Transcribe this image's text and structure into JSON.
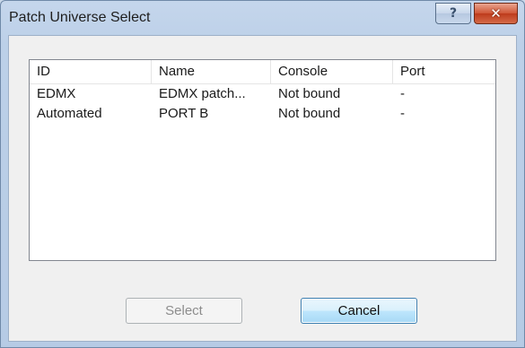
{
  "window": {
    "title": "Patch Universe Select",
    "help_glyph": "?",
    "close_glyph": "✕"
  },
  "list": {
    "columns": [
      "ID",
      "Name",
      "Console",
      "Port"
    ],
    "rows": [
      {
        "id": "EDMX",
        "name": "EDMX patch...",
        "console": "Not bound",
        "port": "-"
      },
      {
        "id": "Automated",
        "name": "PORT B",
        "console": "Not bound",
        "port": "-"
      }
    ]
  },
  "buttons": {
    "select_label": "Select",
    "cancel_label": "Cancel"
  }
}
